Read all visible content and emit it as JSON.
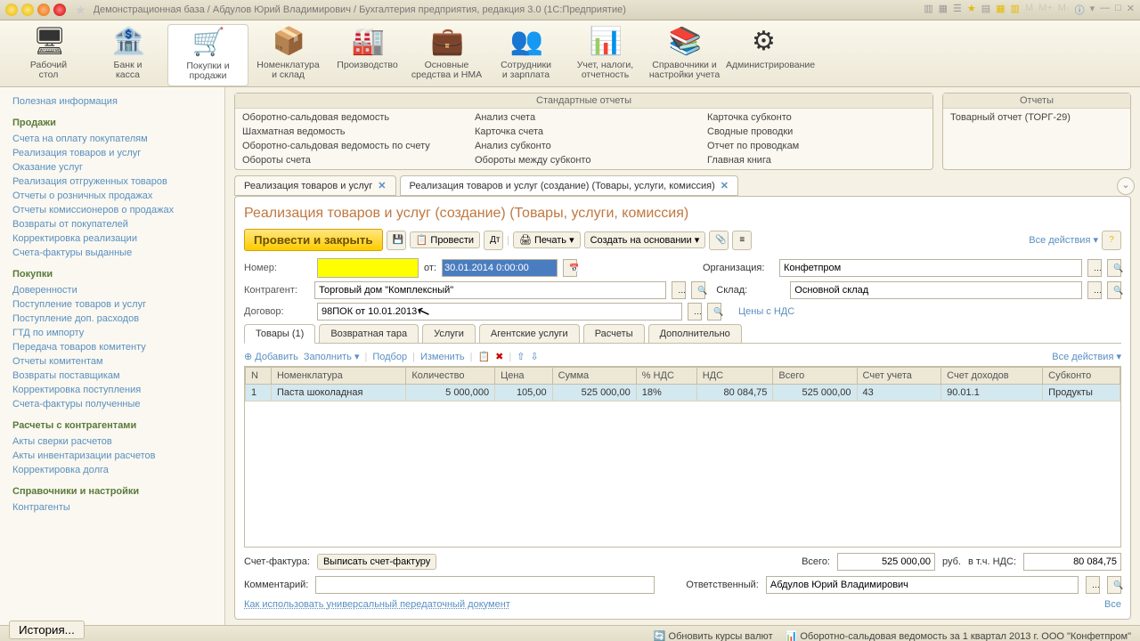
{
  "titlebar": {
    "title": "Демонстрационная база / Абдулов Юрий Владимирович / Бухгалтерия предприятия, редакция 3.0  (1С:Предприятие)"
  },
  "toolbar": [
    {
      "label": "Рабочий\nстол"
    },
    {
      "label": "Банк и\nкасса"
    },
    {
      "label": "Покупки и\nпродажи",
      "active": true
    },
    {
      "label": "Номенклатура\nи склад"
    },
    {
      "label": "Производство"
    },
    {
      "label": "Основные\nсредства и НМА"
    },
    {
      "label": "Сотрудники\nи зарплата"
    },
    {
      "label": "Учет, налоги,\nотчетность"
    },
    {
      "label": "Справочники и\nнастройки учета"
    },
    {
      "label": "Администрирование"
    }
  ],
  "sidebar": {
    "top_link": "Полезная информация",
    "groups": [
      {
        "head": "Продажи",
        "items": [
          "Счета на оплату покупателям",
          "Реализация товаров и услуг",
          "Оказание услуг",
          "Реализация отгруженных товаров",
          "Отчеты о розничных продажах",
          "Отчеты комиссионеров о продажах",
          "Возвраты от покупателей",
          "Корректировка реализации",
          "Счета-фактуры выданные"
        ]
      },
      {
        "head": "Покупки",
        "items": [
          "Доверенности",
          "Поступление товаров и услуг",
          "Поступление доп. расходов",
          "ГТД по импорту",
          "Передача товаров комитенту",
          "Отчеты комитентам",
          "Возвраты поставщикам",
          "Корректировка поступления",
          "Счета-фактуры полученные"
        ]
      },
      {
        "head": "Расчеты с контрагентами",
        "items": [
          "Акты сверки расчетов",
          "Акты инвентаризации расчетов",
          "Корректировка долга"
        ]
      },
      {
        "head": "Справочники и настройки",
        "items": [
          "Контрагенты"
        ]
      }
    ]
  },
  "reports": {
    "std_title": "Стандартные отчеты",
    "cols": [
      [
        "Оборотно-сальдовая ведомость",
        "Шахматная ведомость",
        "Оборотно-сальдовая ведомость по счету",
        "Обороты счета"
      ],
      [
        "Анализ счета",
        "Карточка счета",
        "Анализ субконто",
        "Обороты между субконто"
      ],
      [
        "Карточка субконто",
        "Сводные проводки",
        "Отчет по проводкам",
        "Главная книга"
      ]
    ],
    "other_title": "Отчеты",
    "other": [
      "Товарный отчет (ТОРГ-29)"
    ]
  },
  "doc_tabs": [
    {
      "label": "Реализация товаров и услуг"
    },
    {
      "label": "Реализация товаров и услуг (создание) (Товары, услуги, комиссия)",
      "active": true
    }
  ],
  "doc": {
    "title": "Реализация товаров и услуг (создание) (Товары, услуги, комиссия)",
    "main_btn": "Провести и закрыть",
    "provesti": "Провести",
    "print": "Печать",
    "create_base": "Создать на основании",
    "all_actions": "Все действия",
    "number_lbl": "Номер:",
    "from_lbl": "от:",
    "date_val": "30.01.2014 0:00:00",
    "org_lbl": "Организация:",
    "org_val": "Конфетпром",
    "contr_lbl": "Контрагент:",
    "contr_val": "Торговый дом \"Комплексный\"",
    "sklad_lbl": "Склад:",
    "sklad_val": "Основной склад",
    "dogovor_lbl": "Договор:",
    "dogovor_val": "98ПОК от 10.01.2013",
    "prices_link": "Цены с НДС",
    "sub_tabs": [
      "Товары (1)",
      "Возвратная тара",
      "Услуги",
      "Агентские услуги",
      "Расчеты",
      "Дополнительно"
    ],
    "grid_add": "Добавить",
    "grid_fill": "Заполнить",
    "grid_pick": "Подбор",
    "grid_change": "Изменить",
    "grid_headers": [
      "N",
      "Номенклатура",
      "Количество",
      "Цена",
      "Сумма",
      "% НДС",
      "НДС",
      "Всего",
      "Счет учета",
      "Счет доходов",
      "Субконто"
    ],
    "grid_row": {
      "n": "1",
      "nom": "Паста шоколадная",
      "qty": "5 000,000",
      "price": "105,00",
      "sum": "525 000,00",
      "vatp": "18%",
      "vat": "80 084,75",
      "total": "525 000,00",
      "acc": "43",
      "accd": "90.01.1",
      "sub": "Продукты"
    },
    "sf_lbl": "Счет-фактура:",
    "sf_btn": "Выписать счет-фактуру",
    "total_lbl": "Всего:",
    "total_val": "525 000,00",
    "rub": "руб.",
    "incl_vat": "в т.ч. НДС:",
    "vat_total": "80 084,75",
    "comment_lbl": "Комментарий:",
    "resp_lbl": "Ответственный:",
    "resp_val": "Абдулов Юрий Владимирович",
    "howto": "Как использовать универсальный передаточный документ",
    "all_link": "Все"
  },
  "status": {
    "history": "История...",
    "refresh": "Обновить курсы валют",
    "osv": "Оборотно-сальдовая ведомость за 1 квартал 2013 г. ООО \"Конфетпром\""
  }
}
